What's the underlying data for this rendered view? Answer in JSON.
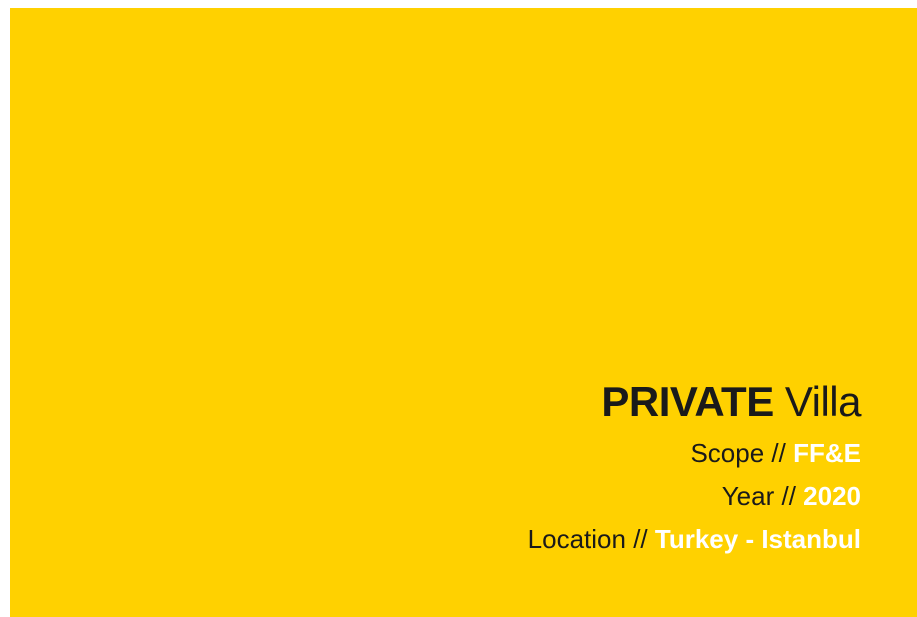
{
  "colors": {
    "background": "#FFD100",
    "text": "#1a1a1a",
    "accent_text": "#ffffff"
  },
  "project": {
    "title_bold": "PRIVATE",
    "title_light": "Villa",
    "details": [
      {
        "label": "Scope",
        "separator": "//",
        "value": "FF&E"
      },
      {
        "label": "Year",
        "separator": "//",
        "value": "2020"
      },
      {
        "label": "Location",
        "separator": "//",
        "value": "Turkey - Istanbul"
      }
    ]
  }
}
